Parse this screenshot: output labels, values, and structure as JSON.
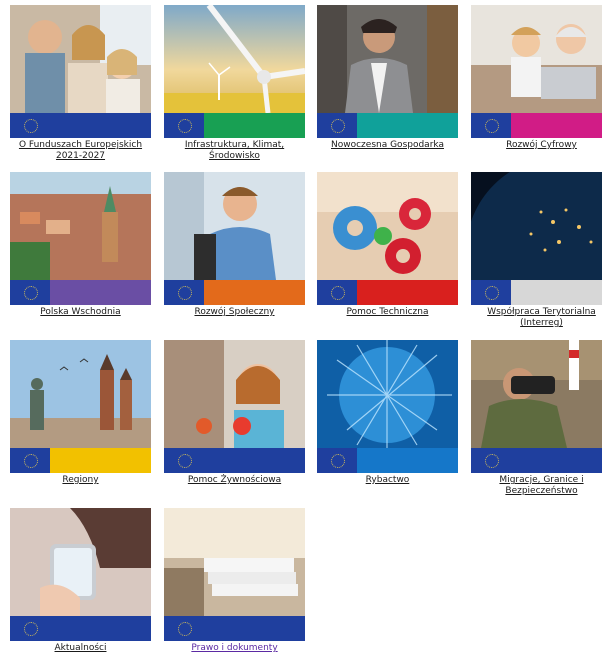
{
  "tiles": [
    {
      "label": "O Funduszach Europejskich 2021-2027",
      "accent": "#1f3f9e",
      "icon": "family-photo"
    },
    {
      "label": "Infrastruktura, Klimat, Środowisko",
      "accent": "#18a053",
      "icon": "wind-turbine-photo"
    },
    {
      "label": "Nowoczesna Gospodarka",
      "accent": "#10a19a",
      "icon": "businessman-photo"
    },
    {
      "label": "Rozwój Cyfrowy",
      "accent": "#d11c86",
      "icon": "grandmother-child-laptop-photo"
    },
    {
      "label": "Polska Wschodnia",
      "accent": "#6a4ea4",
      "icon": "city-aerial-photo"
    },
    {
      "label": "Rozwój Społeczny",
      "accent": "#e36a1b",
      "icon": "student-photo"
    },
    {
      "label": "Pomoc Techniczna",
      "accent": "#d9201e",
      "icon": "gears-photo"
    },
    {
      "label": "Współpraca Terytorialna (Interreg)",
      "accent": "#d7d7d7",
      "icon": "earth-night-photo"
    },
    {
      "label": "Regiony",
      "accent": "#f2c100",
      "icon": "krakow-market-photo"
    },
    {
      "label": "Pomoc Żywnościowa",
      "accent": "#1f3f9e",
      "icon": "girl-with-food-photo"
    },
    {
      "label": "Rybactwo",
      "accent": "#1577c9",
      "icon": "fishing-net-photo"
    },
    {
      "label": "Migracje, Granice i Bezpieczeństwo",
      "accent": "#1f3f9e",
      "icon": "border-guard-binoculars-photo"
    },
    {
      "label": "Aktualności",
      "accent": "#1f3f9e",
      "icon": "smartphone-photo"
    },
    {
      "label": "Prawo i dokumenty",
      "accent": "#1f3f9e",
      "icon": "documents-photo"
    }
  ],
  "colors": {
    "eu_blue": "#1f3f9e",
    "link_visited": "#5b2aa3",
    "text": "#1a1a1a"
  }
}
